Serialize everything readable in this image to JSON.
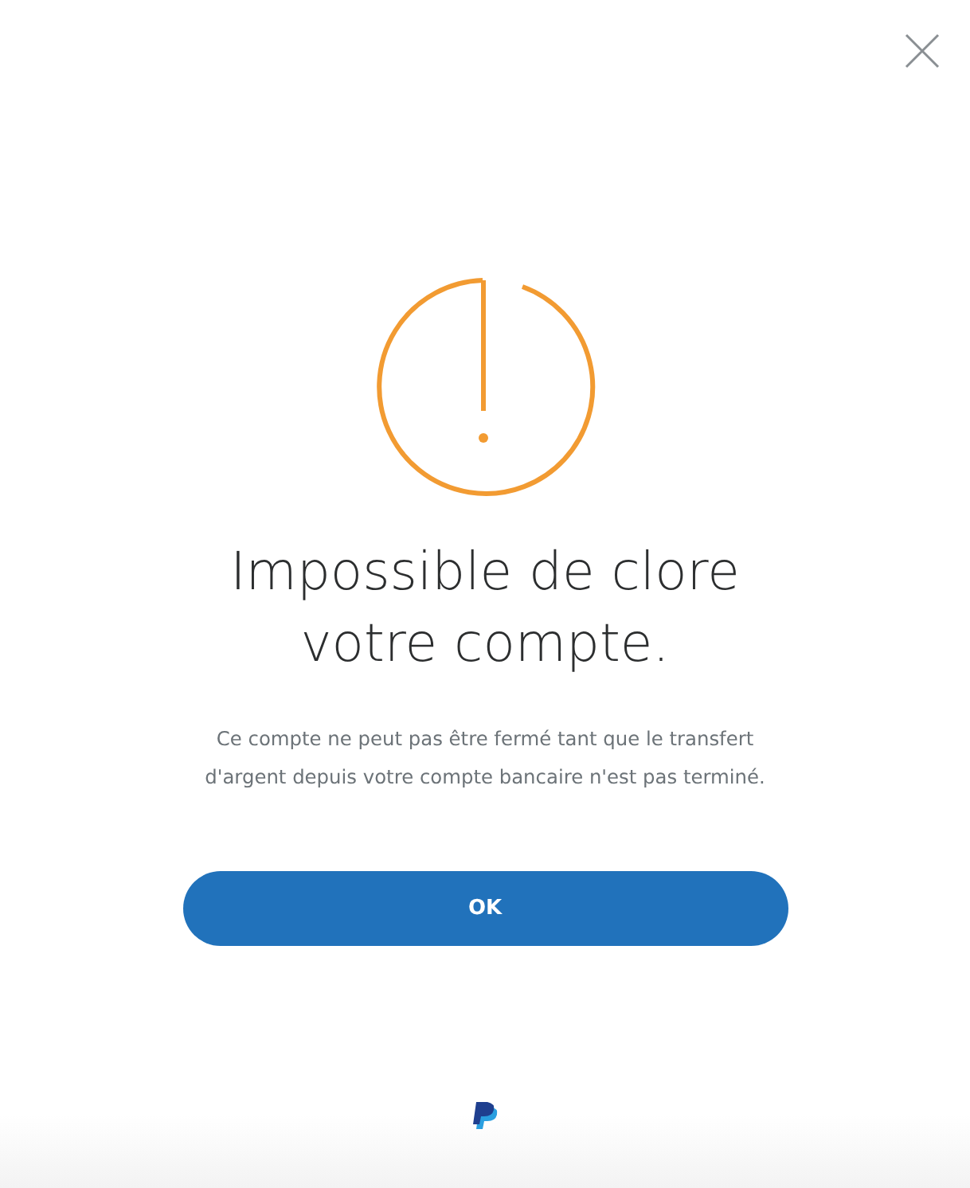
{
  "dialog": {
    "title": "Impossible de clore votre compte.",
    "message": "Ce compte ne peut pas être fermé tant que le transfert d'argent depuis votre compte bancaire n'est pas terminé.",
    "button": "OK"
  }
}
